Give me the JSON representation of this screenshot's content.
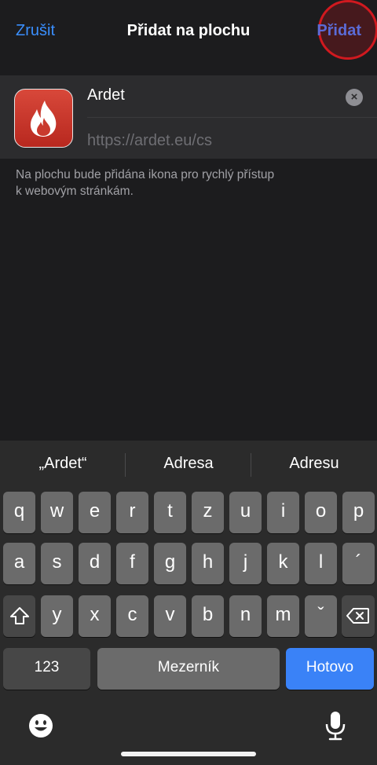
{
  "navbar": {
    "cancel_label": "Zrušit",
    "title": "Přidat na plochu",
    "add_label": "Přidat"
  },
  "bookmark": {
    "name_value": "Ardet",
    "url_value": "https://ardet.eu/cs",
    "clear_symbol": "×"
  },
  "description": {
    "line1": "Na plochu bude přidána ikona pro rychlý přístup",
    "line2": "k webovým stránkám."
  },
  "keyboard": {
    "suggestions": [
      "„Ardet“",
      "Adresa",
      "Adresu"
    ],
    "row1": [
      "q",
      "w",
      "e",
      "r",
      "t",
      "z",
      "u",
      "i",
      "o",
      "p"
    ],
    "row2": [
      "a",
      "s",
      "d",
      "f",
      "g",
      "h",
      "j",
      "k",
      "l",
      "´"
    ],
    "row3": [
      "y",
      "x",
      "c",
      "v",
      "b",
      "n",
      "m",
      "ˇ"
    ],
    "numbers_label": "123",
    "space_label": "Mezerník",
    "done_label": "Hotovo"
  },
  "colors": {
    "accent": "#3a8fff",
    "done_key": "#3a82f7",
    "highlight_ring": "#d0191f",
    "app_icon": "#c93a2e"
  }
}
